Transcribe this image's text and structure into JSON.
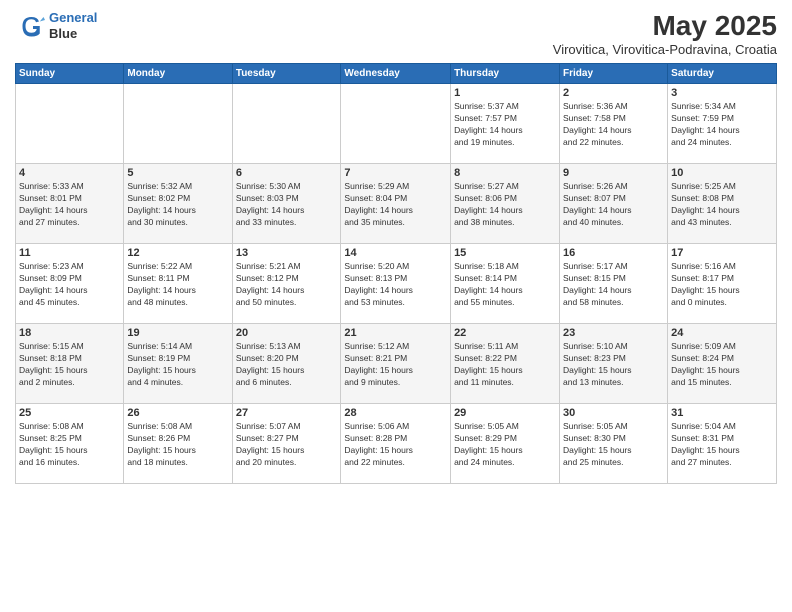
{
  "header": {
    "logo_line1": "General",
    "logo_line2": "Blue",
    "title": "May 2025",
    "subtitle": "Virovitica, Virovitica-Podravina, Croatia"
  },
  "calendar": {
    "days": [
      "Sunday",
      "Monday",
      "Tuesday",
      "Wednesday",
      "Thursday",
      "Friday",
      "Saturday"
    ],
    "weeks": [
      [
        {
          "day": "",
          "info": ""
        },
        {
          "day": "",
          "info": ""
        },
        {
          "day": "",
          "info": ""
        },
        {
          "day": "",
          "info": ""
        },
        {
          "day": "1",
          "info": "Sunrise: 5:37 AM\nSunset: 7:57 PM\nDaylight: 14 hours\nand 19 minutes."
        },
        {
          "day": "2",
          "info": "Sunrise: 5:36 AM\nSunset: 7:58 PM\nDaylight: 14 hours\nand 22 minutes."
        },
        {
          "day": "3",
          "info": "Sunrise: 5:34 AM\nSunset: 7:59 PM\nDaylight: 14 hours\nand 24 minutes."
        }
      ],
      [
        {
          "day": "4",
          "info": "Sunrise: 5:33 AM\nSunset: 8:01 PM\nDaylight: 14 hours\nand 27 minutes."
        },
        {
          "day": "5",
          "info": "Sunrise: 5:32 AM\nSunset: 8:02 PM\nDaylight: 14 hours\nand 30 minutes."
        },
        {
          "day": "6",
          "info": "Sunrise: 5:30 AM\nSunset: 8:03 PM\nDaylight: 14 hours\nand 33 minutes."
        },
        {
          "day": "7",
          "info": "Sunrise: 5:29 AM\nSunset: 8:04 PM\nDaylight: 14 hours\nand 35 minutes."
        },
        {
          "day": "8",
          "info": "Sunrise: 5:27 AM\nSunset: 8:06 PM\nDaylight: 14 hours\nand 38 minutes."
        },
        {
          "day": "9",
          "info": "Sunrise: 5:26 AM\nSunset: 8:07 PM\nDaylight: 14 hours\nand 40 minutes."
        },
        {
          "day": "10",
          "info": "Sunrise: 5:25 AM\nSunset: 8:08 PM\nDaylight: 14 hours\nand 43 minutes."
        }
      ],
      [
        {
          "day": "11",
          "info": "Sunrise: 5:23 AM\nSunset: 8:09 PM\nDaylight: 14 hours\nand 45 minutes."
        },
        {
          "day": "12",
          "info": "Sunrise: 5:22 AM\nSunset: 8:11 PM\nDaylight: 14 hours\nand 48 minutes."
        },
        {
          "day": "13",
          "info": "Sunrise: 5:21 AM\nSunset: 8:12 PM\nDaylight: 14 hours\nand 50 minutes."
        },
        {
          "day": "14",
          "info": "Sunrise: 5:20 AM\nSunset: 8:13 PM\nDaylight: 14 hours\nand 53 minutes."
        },
        {
          "day": "15",
          "info": "Sunrise: 5:18 AM\nSunset: 8:14 PM\nDaylight: 14 hours\nand 55 minutes."
        },
        {
          "day": "16",
          "info": "Sunrise: 5:17 AM\nSunset: 8:15 PM\nDaylight: 14 hours\nand 58 minutes."
        },
        {
          "day": "17",
          "info": "Sunrise: 5:16 AM\nSunset: 8:17 PM\nDaylight: 15 hours\nand 0 minutes."
        }
      ],
      [
        {
          "day": "18",
          "info": "Sunrise: 5:15 AM\nSunset: 8:18 PM\nDaylight: 15 hours\nand 2 minutes."
        },
        {
          "day": "19",
          "info": "Sunrise: 5:14 AM\nSunset: 8:19 PM\nDaylight: 15 hours\nand 4 minutes."
        },
        {
          "day": "20",
          "info": "Sunrise: 5:13 AM\nSunset: 8:20 PM\nDaylight: 15 hours\nand 6 minutes."
        },
        {
          "day": "21",
          "info": "Sunrise: 5:12 AM\nSunset: 8:21 PM\nDaylight: 15 hours\nand 9 minutes."
        },
        {
          "day": "22",
          "info": "Sunrise: 5:11 AM\nSunset: 8:22 PM\nDaylight: 15 hours\nand 11 minutes."
        },
        {
          "day": "23",
          "info": "Sunrise: 5:10 AM\nSunset: 8:23 PM\nDaylight: 15 hours\nand 13 minutes."
        },
        {
          "day": "24",
          "info": "Sunrise: 5:09 AM\nSunset: 8:24 PM\nDaylight: 15 hours\nand 15 minutes."
        }
      ],
      [
        {
          "day": "25",
          "info": "Sunrise: 5:08 AM\nSunset: 8:25 PM\nDaylight: 15 hours\nand 16 minutes."
        },
        {
          "day": "26",
          "info": "Sunrise: 5:08 AM\nSunset: 8:26 PM\nDaylight: 15 hours\nand 18 minutes."
        },
        {
          "day": "27",
          "info": "Sunrise: 5:07 AM\nSunset: 8:27 PM\nDaylight: 15 hours\nand 20 minutes."
        },
        {
          "day": "28",
          "info": "Sunrise: 5:06 AM\nSunset: 8:28 PM\nDaylight: 15 hours\nand 22 minutes."
        },
        {
          "day": "29",
          "info": "Sunrise: 5:05 AM\nSunset: 8:29 PM\nDaylight: 15 hours\nand 24 minutes."
        },
        {
          "day": "30",
          "info": "Sunrise: 5:05 AM\nSunset: 8:30 PM\nDaylight: 15 hours\nand 25 minutes."
        },
        {
          "day": "31",
          "info": "Sunrise: 5:04 AM\nSunset: 8:31 PM\nDaylight: 15 hours\nand 27 minutes."
        }
      ]
    ]
  }
}
